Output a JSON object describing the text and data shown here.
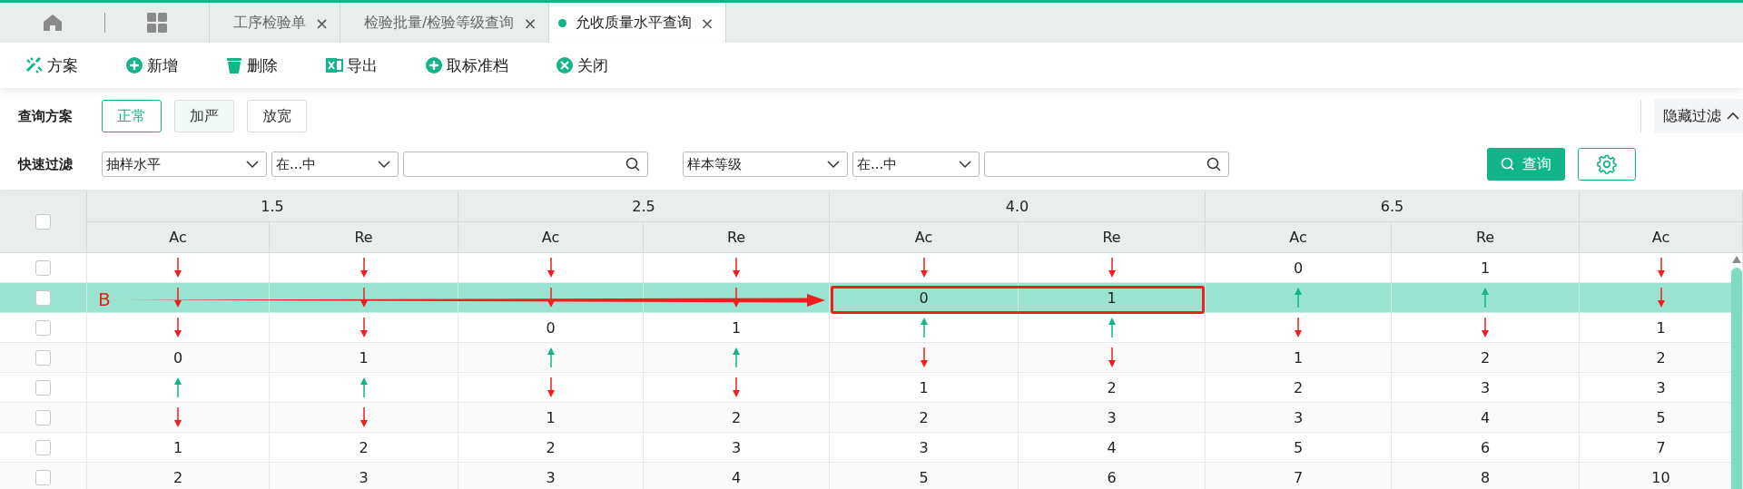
{
  "tabbar": {
    "tabs": [
      {
        "label": "工序检验单",
        "selected": false
      },
      {
        "label": "检验批量/检验等级查询",
        "selected": false
      },
      {
        "label": "允收质量水平查询",
        "selected": true
      }
    ],
    "close_glyph": "×"
  },
  "toolbar": [
    {
      "kind": "scheme",
      "label": "方案"
    },
    {
      "kind": "add",
      "label": "新增"
    },
    {
      "kind": "delete",
      "label": "删除"
    },
    {
      "kind": "excel",
      "label": "导出"
    },
    {
      "kind": "add",
      "label": "取标准档"
    },
    {
      "kind": "close",
      "label": "关闭"
    }
  ],
  "filter": {
    "scheme_label": "查询方案",
    "schemes": [
      {
        "label": "正常",
        "selected": true,
        "hover": false
      },
      {
        "label": "加严",
        "selected": false,
        "hover": true
      },
      {
        "label": "放宽",
        "selected": false,
        "hover": false
      }
    ],
    "hide_button": "隐藏过滤",
    "quick_label": "快速过滤",
    "groups": [
      {
        "field": "抽样水平",
        "operator": "在...中"
      },
      {
        "field": "样本等级",
        "operator": "在...中"
      }
    ],
    "query_button": "查询"
  },
  "table": {
    "header_checked": false,
    "groups": [
      "1.5",
      "2.5",
      "4.0",
      "6.5"
    ],
    "columns": [
      "Ac",
      "Re",
      "Ac",
      "Re",
      "Ac",
      "Re",
      "Ac",
      "Re",
      "Ac"
    ],
    "rows": [
      {
        "selected": false,
        "checked": false,
        "cells": [
          {
            "kind": "down",
            "boxed": false
          },
          {
            "kind": "down",
            "boxed": false
          },
          {
            "kind": "down",
            "boxed": false
          },
          {
            "kind": "down",
            "boxed": false
          },
          {
            "kind": "down",
            "boxed": false
          },
          {
            "kind": "down",
            "boxed": false
          },
          {
            "kind": "number",
            "text": "0",
            "boxed": false
          },
          {
            "kind": "number",
            "text": "1",
            "boxed": false
          },
          {
            "kind": "down",
            "boxed": false
          }
        ]
      },
      {
        "selected": true,
        "checked": false,
        "cells": [
          {
            "kind": "down",
            "boxed": false
          },
          {
            "kind": "down",
            "boxed": false
          },
          {
            "kind": "down",
            "boxed": false
          },
          {
            "kind": "down",
            "boxed": false
          },
          {
            "kind": "number",
            "text": "0",
            "boxed": true
          },
          {
            "kind": "number",
            "text": "1",
            "boxed": true
          },
          {
            "kind": "up",
            "boxed": false
          },
          {
            "kind": "up",
            "boxed": false
          },
          {
            "kind": "down",
            "boxed": false
          }
        ]
      },
      {
        "selected": false,
        "checked": false,
        "cells": [
          {
            "kind": "down",
            "boxed": false
          },
          {
            "kind": "down",
            "boxed": false
          },
          {
            "kind": "number",
            "text": "0",
            "boxed": false
          },
          {
            "kind": "number",
            "text": "1",
            "boxed": false
          },
          {
            "kind": "up",
            "boxed": false
          },
          {
            "kind": "up",
            "boxed": false
          },
          {
            "kind": "down",
            "boxed": false
          },
          {
            "kind": "down",
            "boxed": false
          },
          {
            "kind": "number",
            "text": "1",
            "boxed": false
          }
        ]
      },
      {
        "selected": false,
        "checked": false,
        "cells": [
          {
            "kind": "number",
            "text": "0",
            "boxed": false
          },
          {
            "kind": "number",
            "text": "1",
            "boxed": false
          },
          {
            "kind": "up",
            "boxed": false
          },
          {
            "kind": "up",
            "boxed": false
          },
          {
            "kind": "down",
            "boxed": false
          },
          {
            "kind": "down",
            "boxed": false
          },
          {
            "kind": "number",
            "text": "1",
            "boxed": false
          },
          {
            "kind": "number",
            "text": "2",
            "boxed": false
          },
          {
            "kind": "number",
            "text": "2",
            "boxed": false
          }
        ]
      },
      {
        "selected": false,
        "checked": false,
        "cells": [
          {
            "kind": "up",
            "boxed": false
          },
          {
            "kind": "up",
            "boxed": false
          },
          {
            "kind": "down",
            "boxed": false
          },
          {
            "kind": "down",
            "boxed": false
          },
          {
            "kind": "number",
            "text": "1",
            "boxed": false
          },
          {
            "kind": "number",
            "text": "2",
            "boxed": false
          },
          {
            "kind": "number",
            "text": "2",
            "boxed": false
          },
          {
            "kind": "number",
            "text": "3",
            "boxed": false
          },
          {
            "kind": "number",
            "text": "3",
            "boxed": false
          }
        ]
      },
      {
        "selected": false,
        "checked": false,
        "cells": [
          {
            "kind": "down",
            "boxed": false
          },
          {
            "kind": "down",
            "boxed": false
          },
          {
            "kind": "number",
            "text": "1",
            "boxed": false
          },
          {
            "kind": "number",
            "text": "2",
            "boxed": false
          },
          {
            "kind": "number",
            "text": "2",
            "boxed": false
          },
          {
            "kind": "number",
            "text": "3",
            "boxed": false
          },
          {
            "kind": "number",
            "text": "3",
            "boxed": false
          },
          {
            "kind": "number",
            "text": "4",
            "boxed": false
          },
          {
            "kind": "number",
            "text": "5",
            "boxed": false
          }
        ]
      },
      {
        "selected": false,
        "checked": false,
        "cells": [
          {
            "kind": "number",
            "text": "1",
            "boxed": false
          },
          {
            "kind": "number",
            "text": "2",
            "boxed": false
          },
          {
            "kind": "number",
            "text": "2",
            "boxed": false
          },
          {
            "kind": "number",
            "text": "3",
            "boxed": false
          },
          {
            "kind": "number",
            "text": "3",
            "boxed": false
          },
          {
            "kind": "number",
            "text": "4",
            "boxed": false
          },
          {
            "kind": "number",
            "text": "5",
            "boxed": false
          },
          {
            "kind": "number",
            "text": "6",
            "boxed": false
          },
          {
            "kind": "number",
            "text": "7",
            "boxed": false
          }
        ]
      },
      {
        "selected": false,
        "checked": false,
        "cells": [
          {
            "kind": "number",
            "text": "2",
            "boxed": false
          },
          {
            "kind": "number",
            "text": "3",
            "boxed": false
          },
          {
            "kind": "number",
            "text": "3",
            "boxed": false
          },
          {
            "kind": "number",
            "text": "4",
            "boxed": false
          },
          {
            "kind": "number",
            "text": "5",
            "boxed": false
          },
          {
            "kind": "number",
            "text": "6",
            "boxed": false
          },
          {
            "kind": "number",
            "text": "7",
            "boxed": false
          },
          {
            "kind": "number",
            "text": "8",
            "boxed": false
          },
          {
            "kind": "number",
            "text": "10",
            "boxed": false
          }
        ]
      }
    ],
    "annotation": {
      "label": "B"
    }
  }
}
